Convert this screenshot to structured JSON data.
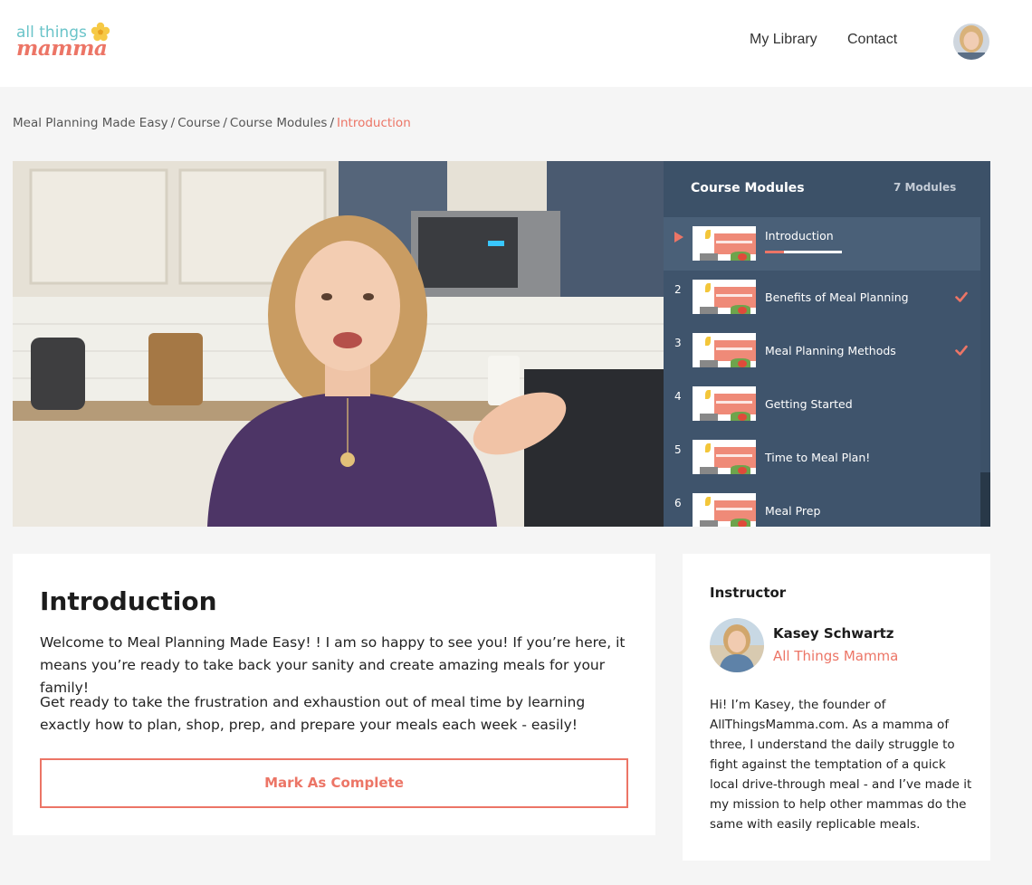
{
  "header": {
    "logo_top": "all things",
    "logo_bottom": "mamma",
    "nav": {
      "library": "My Library",
      "contact": "Contact"
    }
  },
  "breadcrumb": {
    "items": [
      "Meal Planning Made Easy",
      "Course",
      "Course Modules"
    ],
    "separator": "/",
    "current": "Introduction"
  },
  "modules_panel": {
    "title": "Course Modules",
    "count": "7 Modules",
    "items": [
      {
        "num": "",
        "label": "Introduction",
        "status": "playing",
        "progress": 0.25,
        "thumb_text": "INTRODUCTION"
      },
      {
        "num": "2",
        "label": "Benefits of Meal Planning",
        "status": "complete",
        "thumb_text": "BENEFITS OF MEAL PLANNING"
      },
      {
        "num": "3",
        "label": "Meal Planning Methods",
        "status": "complete",
        "thumb_text": "MEAL PLANNING METHODS"
      },
      {
        "num": "4",
        "label": "Getting Started",
        "status": "",
        "thumb_text": "GETTING STARTED"
      },
      {
        "num": "5",
        "label": "Time to Meal Plan!",
        "status": "",
        "thumb_text": "TIME TO MEAL PLAN"
      },
      {
        "num": "6",
        "label": "Meal Prep",
        "status": "",
        "thumb_text": "MEAL PREP"
      }
    ]
  },
  "lesson": {
    "title": "Introduction",
    "paragraph_1": "Welcome to Meal Planning Made Easy! ! I am so happy to see you! If you’re here, it means you’re ready to take back your sanity and create amazing meals for your family!",
    "paragraph_2": "Get ready to take the frustration and exhaustion out of meal time by learning exactly how to plan, shop, prep, and prepare your meals each week - easily!",
    "complete_button": "Mark As Complete"
  },
  "instructor": {
    "heading": "Instructor",
    "name": "Kasey Schwartz",
    "site": "All Things Mamma",
    "bio": "Hi! I’m Kasey, the founder of AllThingsMamma.com. As a mamma of three, I understand the daily struggle to fight against the temptation of a quick local drive-through meal - and I’ve made it my mission to help other mammas do the same with easily replicable meals."
  },
  "colors": {
    "accent": "#ec7566",
    "panel": "#3f546c",
    "panel_active": "#4a6078",
    "logo_teal": "#6ac4c9"
  },
  "icons": {
    "play": "play-triangle-icon",
    "check": "checkmark-icon",
    "logo_flower": "flower-icon"
  }
}
